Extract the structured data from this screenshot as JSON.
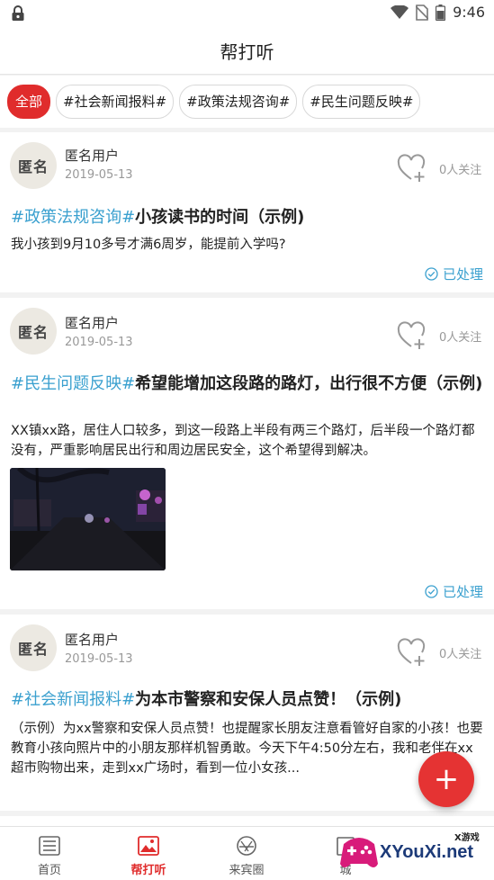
{
  "statusbar": {
    "time": "9:46"
  },
  "header": {
    "title": "帮打听"
  },
  "tags": [
    "全部",
    "#社会新闻报料#",
    "#政策法规咨询#",
    "#民生问题反映#"
  ],
  "posts": [
    {
      "avatar": "匿名",
      "user": "匿名用户",
      "date": "2019-05-13",
      "follow": "0人关注",
      "category": "#政策法规咨询#",
      "title": "小孩读书的时间（示例)",
      "body": "我小孩到9月10多号才满6周岁，能提前入学吗?",
      "status": "已处理"
    },
    {
      "avatar": "匿名",
      "user": "匿名用户",
      "date": "2019-05-13",
      "follow": "0人关注",
      "category": "#民生问题反映#",
      "title": "希望能增加这段路的路灯，出行很不方便（示例)",
      "body": "XX镇xx路，居住人口较多，到这一段路上半段有两三个路灯，后半段一个路灯都没有，严重影响居民出行和周边居民安全，这个希望得到解决。",
      "status": "已处理"
    },
    {
      "avatar": "匿名",
      "user": "匿名用户",
      "date": "2019-05-13",
      "follow": "0人关注",
      "category": "#社会新闻报料#",
      "title": "为本市警察和安保人员点赞！（示例)",
      "body": "（示例）为xx警察和安保人员点赞！也提醒家长朋友注意看管好自家的小孩！也要教育小孩向照片中的小朋友那样机智勇敢。今天下午4:50分左右，我和老伴在xx超市购物出来，走到xx广场时，看到一位小女孩..."
    }
  ],
  "fab": "+",
  "nav": [
    {
      "label": "首页",
      "icon": "news-icon"
    },
    {
      "label": "帮打听",
      "icon": "image-icon"
    },
    {
      "label": "来宾圈",
      "icon": "circle-icon"
    },
    {
      "label": "城",
      "icon": "city-icon"
    }
  ],
  "watermark": {
    "text": "XYouXi.net",
    "small": "X游戏"
  },
  "colors": {
    "accent": "#e02c2c",
    "link": "#3aa0cf"
  }
}
